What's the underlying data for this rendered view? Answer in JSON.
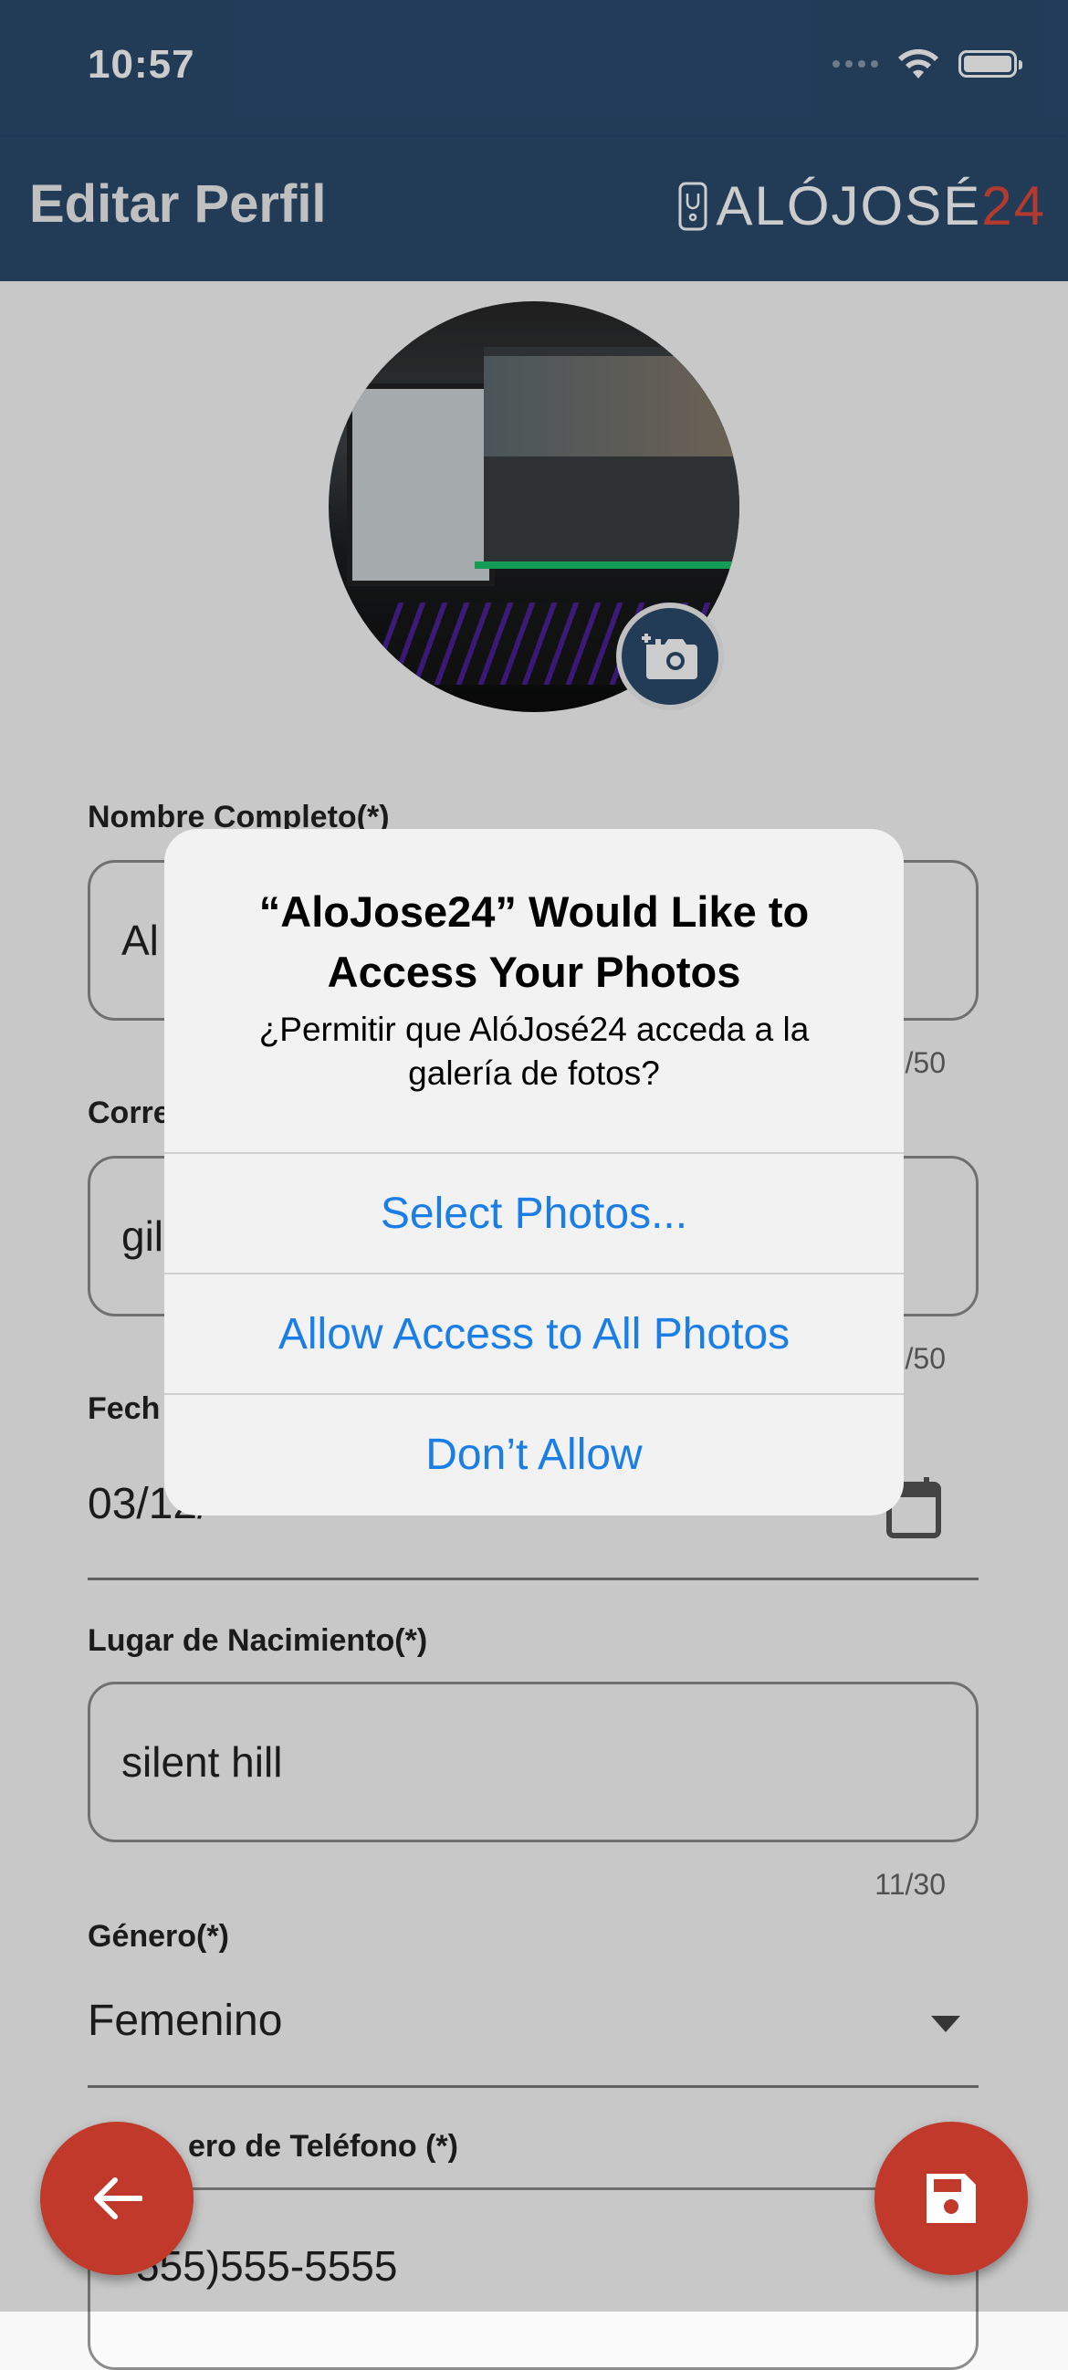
{
  "status_bar": {
    "time": "10:57"
  },
  "app_bar": {
    "title": "Editar Perfil",
    "logo_text": "ALÓJOSÉ",
    "logo_number": "24"
  },
  "form": {
    "full_name": {
      "label": "Nombre Completo(*)",
      "value": "Al",
      "counter": "/50"
    },
    "email": {
      "label": "Corre",
      "value": "gil",
      "counter": "/50"
    },
    "birth_date": {
      "label": "Fech",
      "value": "03/12/"
    },
    "birth_place": {
      "label": "Lugar de Nacimiento(*)",
      "value": "silent hill",
      "counter": "11/30"
    },
    "gender": {
      "label": "Género(*)",
      "value": "Femenino"
    },
    "phone": {
      "label": "ero de Teléfono (*)",
      "value": "555)555-5555"
    }
  },
  "alert": {
    "title": "“AloJose24” Would Like to Access Your Photos",
    "message": "¿Permitir que AlóJosé24 acceda a la galería de fotos?",
    "buttons": [
      "Select Photos...",
      "Allow Access to All Photos",
      "Don’t Allow"
    ]
  },
  "icons": {
    "back": "arrow-left-icon",
    "save": "floppy-disk-icon",
    "camera": "add-camera-icon",
    "calendar": "calendar-icon",
    "dropdown": "caret-down-icon"
  },
  "colors": {
    "primary": "#2b4b6f",
    "accent": "#c0392b",
    "ios_blue": "#1a7ee6"
  }
}
